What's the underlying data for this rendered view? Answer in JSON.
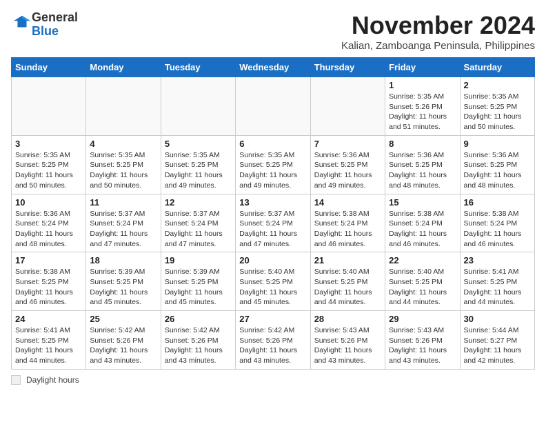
{
  "logo": {
    "general": "General",
    "blue": "Blue"
  },
  "title": "November 2024",
  "subtitle": "Kalian, Zamboanga Peninsula, Philippines",
  "days_of_week": [
    "Sunday",
    "Monday",
    "Tuesday",
    "Wednesday",
    "Thursday",
    "Friday",
    "Saturday"
  ],
  "weeks": [
    [
      {
        "day": "",
        "info": ""
      },
      {
        "day": "",
        "info": ""
      },
      {
        "day": "",
        "info": ""
      },
      {
        "day": "",
        "info": ""
      },
      {
        "day": "",
        "info": ""
      },
      {
        "day": "1",
        "info": "Sunrise: 5:35 AM\nSunset: 5:26 PM\nDaylight: 11 hours and 51 minutes."
      },
      {
        "day": "2",
        "info": "Sunrise: 5:35 AM\nSunset: 5:25 PM\nDaylight: 11 hours and 50 minutes."
      }
    ],
    [
      {
        "day": "3",
        "info": "Sunrise: 5:35 AM\nSunset: 5:25 PM\nDaylight: 11 hours and 50 minutes."
      },
      {
        "day": "4",
        "info": "Sunrise: 5:35 AM\nSunset: 5:25 PM\nDaylight: 11 hours and 50 minutes."
      },
      {
        "day": "5",
        "info": "Sunrise: 5:35 AM\nSunset: 5:25 PM\nDaylight: 11 hours and 49 minutes."
      },
      {
        "day": "6",
        "info": "Sunrise: 5:35 AM\nSunset: 5:25 PM\nDaylight: 11 hours and 49 minutes."
      },
      {
        "day": "7",
        "info": "Sunrise: 5:36 AM\nSunset: 5:25 PM\nDaylight: 11 hours and 49 minutes."
      },
      {
        "day": "8",
        "info": "Sunrise: 5:36 AM\nSunset: 5:25 PM\nDaylight: 11 hours and 48 minutes."
      },
      {
        "day": "9",
        "info": "Sunrise: 5:36 AM\nSunset: 5:25 PM\nDaylight: 11 hours and 48 minutes."
      }
    ],
    [
      {
        "day": "10",
        "info": "Sunrise: 5:36 AM\nSunset: 5:24 PM\nDaylight: 11 hours and 48 minutes."
      },
      {
        "day": "11",
        "info": "Sunrise: 5:37 AM\nSunset: 5:24 PM\nDaylight: 11 hours and 47 minutes."
      },
      {
        "day": "12",
        "info": "Sunrise: 5:37 AM\nSunset: 5:24 PM\nDaylight: 11 hours and 47 minutes."
      },
      {
        "day": "13",
        "info": "Sunrise: 5:37 AM\nSunset: 5:24 PM\nDaylight: 11 hours and 47 minutes."
      },
      {
        "day": "14",
        "info": "Sunrise: 5:38 AM\nSunset: 5:24 PM\nDaylight: 11 hours and 46 minutes."
      },
      {
        "day": "15",
        "info": "Sunrise: 5:38 AM\nSunset: 5:24 PM\nDaylight: 11 hours and 46 minutes."
      },
      {
        "day": "16",
        "info": "Sunrise: 5:38 AM\nSunset: 5:24 PM\nDaylight: 11 hours and 46 minutes."
      }
    ],
    [
      {
        "day": "17",
        "info": "Sunrise: 5:38 AM\nSunset: 5:25 PM\nDaylight: 11 hours and 46 minutes."
      },
      {
        "day": "18",
        "info": "Sunrise: 5:39 AM\nSunset: 5:25 PM\nDaylight: 11 hours and 45 minutes."
      },
      {
        "day": "19",
        "info": "Sunrise: 5:39 AM\nSunset: 5:25 PM\nDaylight: 11 hours and 45 minutes."
      },
      {
        "day": "20",
        "info": "Sunrise: 5:40 AM\nSunset: 5:25 PM\nDaylight: 11 hours and 45 minutes."
      },
      {
        "day": "21",
        "info": "Sunrise: 5:40 AM\nSunset: 5:25 PM\nDaylight: 11 hours and 44 minutes."
      },
      {
        "day": "22",
        "info": "Sunrise: 5:40 AM\nSunset: 5:25 PM\nDaylight: 11 hours and 44 minutes."
      },
      {
        "day": "23",
        "info": "Sunrise: 5:41 AM\nSunset: 5:25 PM\nDaylight: 11 hours and 44 minutes."
      }
    ],
    [
      {
        "day": "24",
        "info": "Sunrise: 5:41 AM\nSunset: 5:25 PM\nDaylight: 11 hours and 44 minutes."
      },
      {
        "day": "25",
        "info": "Sunrise: 5:42 AM\nSunset: 5:26 PM\nDaylight: 11 hours and 43 minutes."
      },
      {
        "day": "26",
        "info": "Sunrise: 5:42 AM\nSunset: 5:26 PM\nDaylight: 11 hours and 43 minutes."
      },
      {
        "day": "27",
        "info": "Sunrise: 5:42 AM\nSunset: 5:26 PM\nDaylight: 11 hours and 43 minutes."
      },
      {
        "day": "28",
        "info": "Sunrise: 5:43 AM\nSunset: 5:26 PM\nDaylight: 11 hours and 43 minutes."
      },
      {
        "day": "29",
        "info": "Sunrise: 5:43 AM\nSunset: 5:26 PM\nDaylight: 11 hours and 43 minutes."
      },
      {
        "day": "30",
        "info": "Sunrise: 5:44 AM\nSunset: 5:27 PM\nDaylight: 11 hours and 42 minutes."
      }
    ]
  ],
  "legend": {
    "daylight_label": "Daylight hours"
  },
  "colors": {
    "header_bg": "#1a6fc4",
    "header_text": "#ffffff"
  }
}
